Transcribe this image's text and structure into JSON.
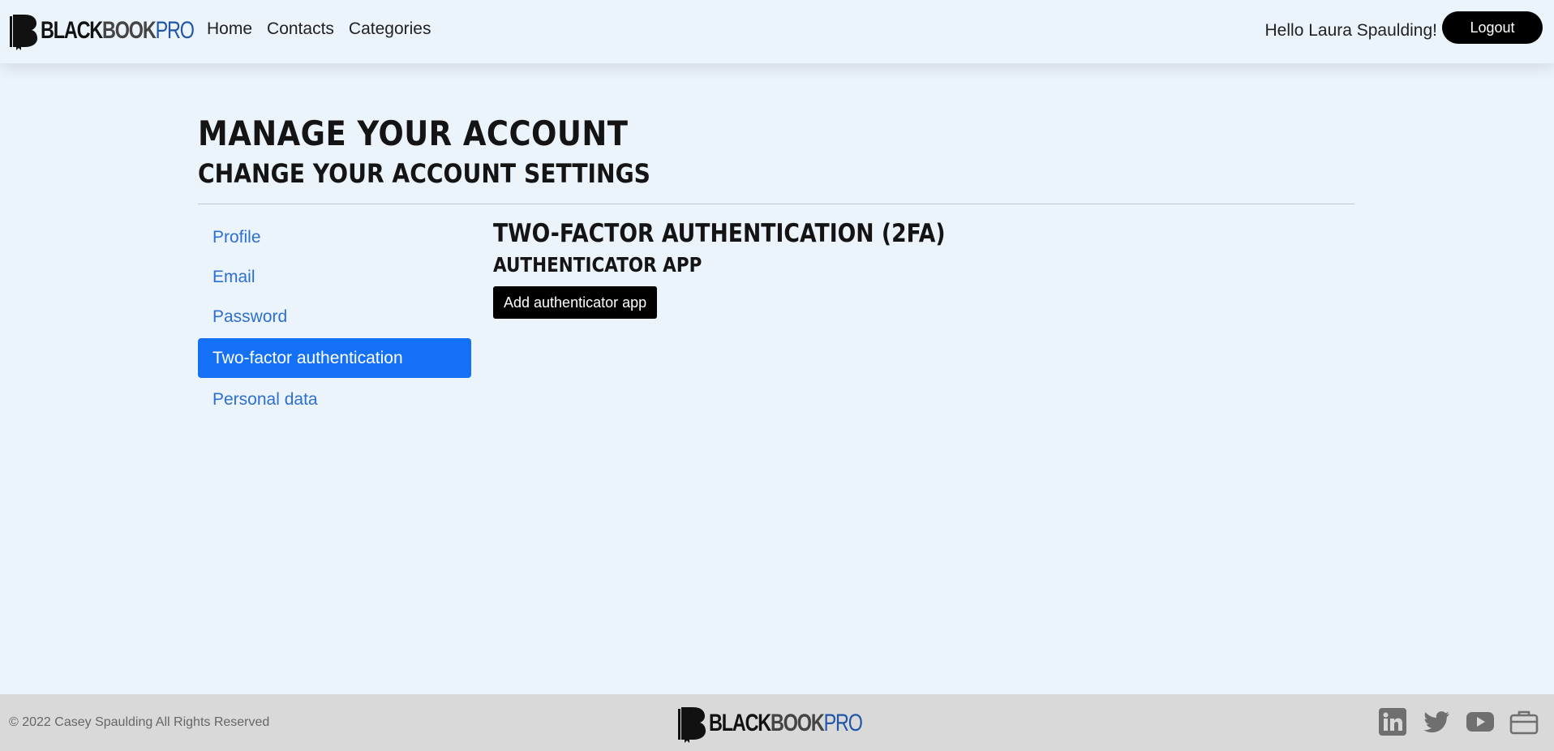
{
  "header": {
    "brand": {
      "part1": "BLACK",
      "part2": "BOOK",
      "part3": "PRO"
    },
    "nav": [
      "Home",
      "Contacts",
      "Categories"
    ],
    "greeting": "Hello Laura Spaulding!",
    "logout_label": "Logout"
  },
  "main": {
    "title": "MANAGE YOUR ACCOUNT",
    "subtitle": "CHANGE YOUR ACCOUNT SETTINGS",
    "side_nav": [
      {
        "label": "Profile",
        "active": false
      },
      {
        "label": "Email",
        "active": false
      },
      {
        "label": "Password",
        "active": false
      },
      {
        "label": "Two-factor authentication",
        "active": true
      },
      {
        "label": "Personal data",
        "active": false
      }
    ],
    "section_title": "TWO-FACTOR AUTHENTICATION (2FA)",
    "section_subtitle": "AUTHENTICATOR APP",
    "add_button_label": "Add authenticator app"
  },
  "footer": {
    "copyright": "© 2022 Casey Spaulding All Rights Reserved",
    "social_icons": [
      "linkedin-icon",
      "twitter-icon",
      "youtube-icon",
      "briefcase-icon"
    ]
  },
  "colors": {
    "page_bg": "#ebf3fb",
    "accent": "#1471f5",
    "link": "#2d6fd0",
    "footer_bg": "#d9d9d9",
    "brand_blue": "#2256a8"
  }
}
